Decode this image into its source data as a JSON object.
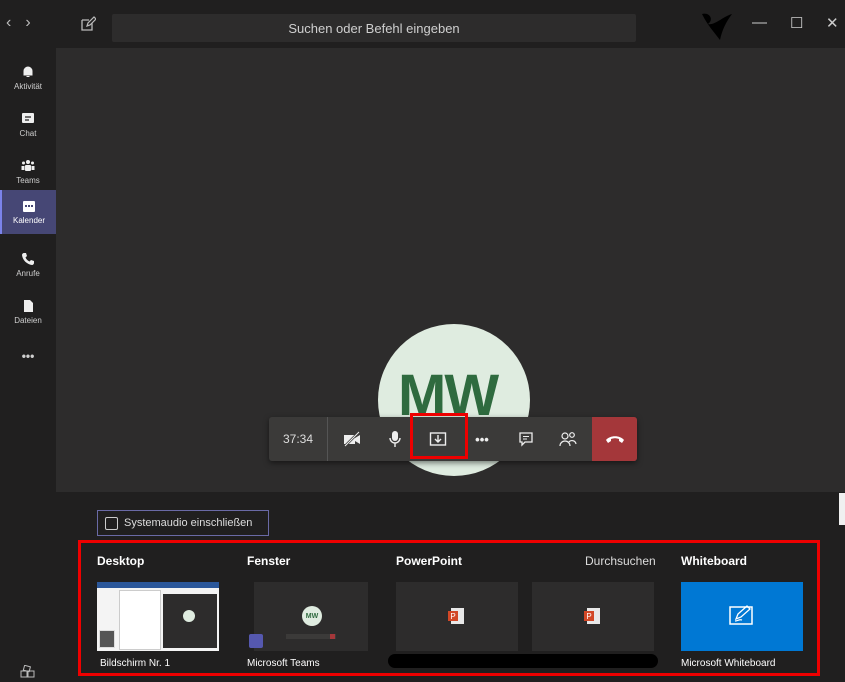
{
  "search": {
    "text": "Suchen oder Befehl eingeben"
  },
  "nav": {
    "back": "‹",
    "forward": "›"
  },
  "window": {
    "minimize": "—",
    "maximize": "☐",
    "close": "✕"
  },
  "rail": [
    {
      "label": "Aktivität",
      "icon": "bell-icon"
    },
    {
      "label": "Chat",
      "icon": "chat-icon"
    },
    {
      "label": "Teams",
      "icon": "teams-icon"
    },
    {
      "label": "Kalender",
      "icon": "calendar-icon",
      "active": true
    },
    {
      "label": "Anrufe",
      "icon": "phone-icon"
    },
    {
      "label": "Dateien",
      "icon": "file-icon"
    }
  ],
  "rail_more": "•••",
  "call": {
    "initials": "MW",
    "timer": "37:34",
    "more": "•••"
  },
  "share": {
    "system_audio": "Systemaudio einschließen",
    "sections": {
      "desktop": "Desktop",
      "window": "Fenster",
      "powerpoint": "PowerPoint",
      "browse": "Durchsuchen",
      "whiteboard": "Whiteboard"
    },
    "captions": {
      "desktop": "Bildschirm Nr. 1",
      "window": "Microsoft Teams",
      "whiteboard": "Microsoft Whiteboard"
    },
    "thumb_initials": "MW"
  },
  "colors": {
    "accent": "#464775",
    "hangup": "#a4373a",
    "whiteboard": "#0078d4",
    "annotation": "#ee0000"
  }
}
